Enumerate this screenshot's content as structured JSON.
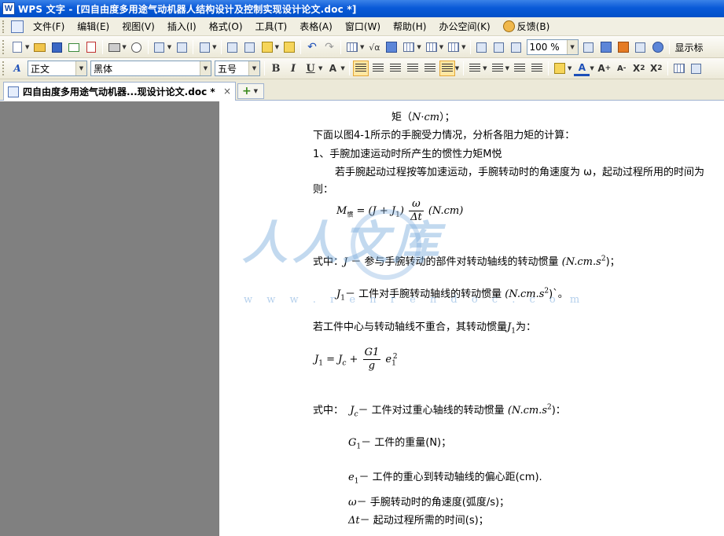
{
  "window": {
    "title": "WPS 文字 - [四自由度多用途气动机器人结构设计及控制实现设计论文.doc *]",
    "app_icon_letter": "W"
  },
  "menu": {
    "items": [
      "文件(F)",
      "编辑(E)",
      "视图(V)",
      "插入(I)",
      "格式(O)",
      "工具(T)",
      "表格(A)",
      "窗口(W)",
      "帮助(H)",
      "办公空间(K)"
    ],
    "feedback": "反馈(B)"
  },
  "toolbar1": {
    "zoom": "100 %",
    "right_label": "显示标"
  },
  "toolbar2": {
    "style": "正文",
    "font": "黑体",
    "size": "五号"
  },
  "tab": {
    "label": "四自由度多用途气动机器...现设计论文.doc *",
    "close": "×",
    "new": "+"
  },
  "watermark": {
    "text": "人人文库",
    "url": "w w w . r e n r e n d o c . c o m"
  },
  "doc": {
    "l1_a": "矩（",
    "l1_b": "N",
    "l1_c": "·",
    "l1_d": "cm",
    "l1_e": "）；",
    "l2": "下面以图4-1所示的手腕受力情况，分析各阻力矩的计算：",
    "l3": "1、手腕加速运动时所产生的惯性力矩M悦",
    "l4": "若手腕起动过程按等加速运动，手腕转动时的角速度为 ω，起动过程所用的时间为",
    "l5": "则：",
    "eq1_lhs": "M",
    "eq1_sub": "惯",
    "eq1_mid": "= (J + J",
    "eq1_mid_sub": "1",
    "eq1_mid2": ")",
    "eq1_num": "ω",
    "eq1_den": "Δt",
    "eq1_rhs": "(N.cm)",
    "l6_pre": "式中：",
    "l6_var": "J",
    "l6_text": "－ 参与手腕转动的部件对转动轴线的转动惯量",
    "l6_unit": "(N.cm.s",
    "l6_unit_sup": "2",
    "l6_unit_end": ")；",
    "l7_var": "J",
    "l7_sub": "1",
    "l7_text": "－ 工件对手腕转动轴线的转动惯量",
    "l7_unit": "(N.cm.s",
    "l7_unit_sup": "2",
    "l7_unit_end": ")`。",
    "l8_a": "若工件中心与转动轴线不重合，其转动惯量",
    "l8_var": "J",
    "l8_sub": "1",
    "l8_b": "为：",
    "eq2_lhs": "J",
    "eq2_lhs_sub": "1",
    "eq2_eq": "= J",
    "eq2_c": "c",
    "eq2_plus": "+",
    "eq2_num": "G1",
    "eq2_den": "g",
    "eq2_e": "e",
    "eq2_e_sub": "1",
    "eq2_e_sup": "2",
    "l9_pre": "式中：",
    "l9_var": "J",
    "l9_sub": "c",
    "l9_text": "－ 工件对过重心轴线的转动惯量",
    "l9_unit": "(N.cm.s",
    "l9_unit_sup": "2",
    "l9_unit_end": ")：",
    "l10_var": "G",
    "l10_sub": "1",
    "l10_text": "－ 工件的重量(N)；",
    "l11_var": "e",
    "l11_sub": "1",
    "l11_text": "－ 工件的重心到转动轴线的偏心距(cm).",
    "l12_var": "ω",
    "l12_text": "－ 手腕转动时的角速度(弧度/s)；",
    "l13_var": "Δt",
    "l13_text": "－ 起动过程所需的时间(s)；"
  }
}
